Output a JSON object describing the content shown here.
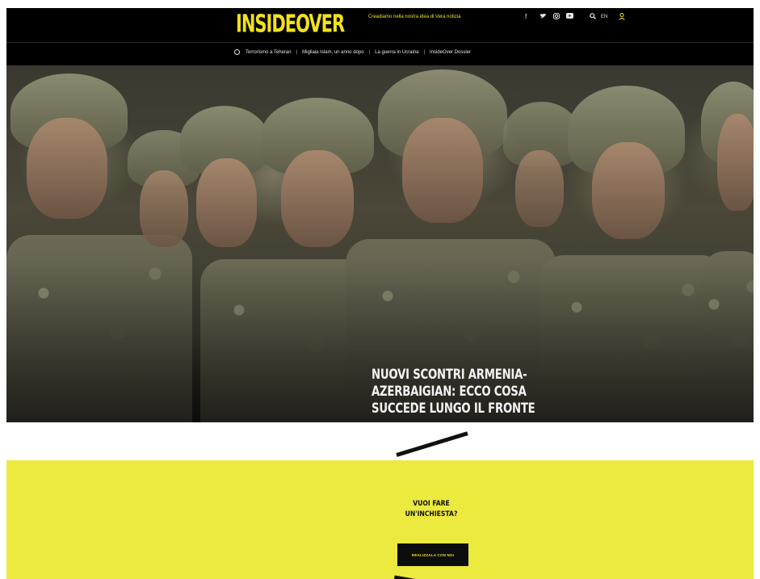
{
  "header": {
    "logo_text": "INSIDEOVER",
    "promo_text": "Creadiamo nella nostra idea di Vera notizia",
    "social_icons": [
      "facebook-icon",
      "twitter-icon",
      "instagram-icon",
      "youtube-icon"
    ],
    "search_icon": "search-icon",
    "language": "EN",
    "user_icon": "user-icon",
    "brand_color": "#f2e21b"
  },
  "nav": {
    "items": [
      "Terrorismo a Teheran",
      "Migliaia Islam, un anno dopo",
      "La guerra in Ucraina",
      "InsideOver Dossier"
    ]
  },
  "hero": {
    "headline_line1": "NUOVI SCONTRI ARMENIA-AZERBAIGIAN: ECCO COSA",
    "headline_line2": "SUCCEDE LUNGO IL FRONTE"
  },
  "cta": {
    "title_line1": "VUOI FARE",
    "title_line2": "UN'INCHIESTA?",
    "button_label": "REALIZZALA CON NOI",
    "background_color": "#ecea3f"
  }
}
